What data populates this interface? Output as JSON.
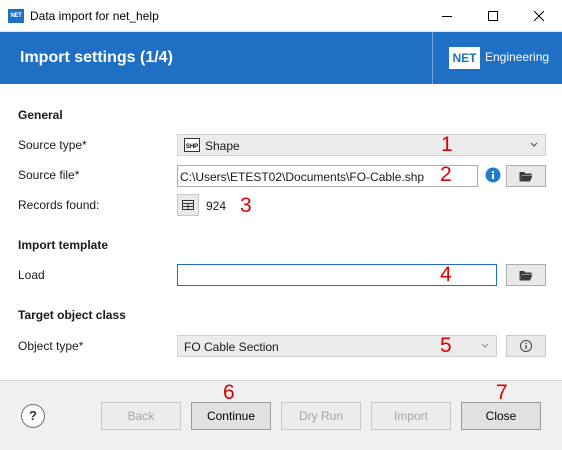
{
  "window": {
    "title": "Data import for net_help",
    "app_icon_text": "NET",
    "controls": [
      "minimize-icon",
      "maximize-icon",
      "close-icon"
    ]
  },
  "banner": {
    "title": "Import settings (1/4)",
    "brand_logo": "NET",
    "brand_name": "Engineering",
    "color": "#1f6fc5"
  },
  "general": {
    "heading": "General",
    "source_type_label": "Source type*",
    "source_type_value": "Shape",
    "source_type_icon": "shapefile-icon",
    "source_file_label": "Source file*",
    "source_file_value": "C:\\Users\\ETEST02\\Documents\\FO-Cable.shp",
    "records_label": "Records found:",
    "records_value": "924"
  },
  "import_template": {
    "heading": "Import template",
    "load_label": "Load",
    "load_value": ""
  },
  "target": {
    "heading": "Target object class",
    "object_type_label": "Object type*",
    "object_type_value": "FO Cable Section"
  },
  "footer": {
    "help": "?",
    "back": "Back",
    "continue": "Continue",
    "dry_run": "Dry Run",
    "import": "Import",
    "close": "Close"
  },
  "annotations": [
    "1",
    "2",
    "3",
    "4",
    "5",
    "6",
    "7"
  ],
  "annotation_color": "#e00000"
}
